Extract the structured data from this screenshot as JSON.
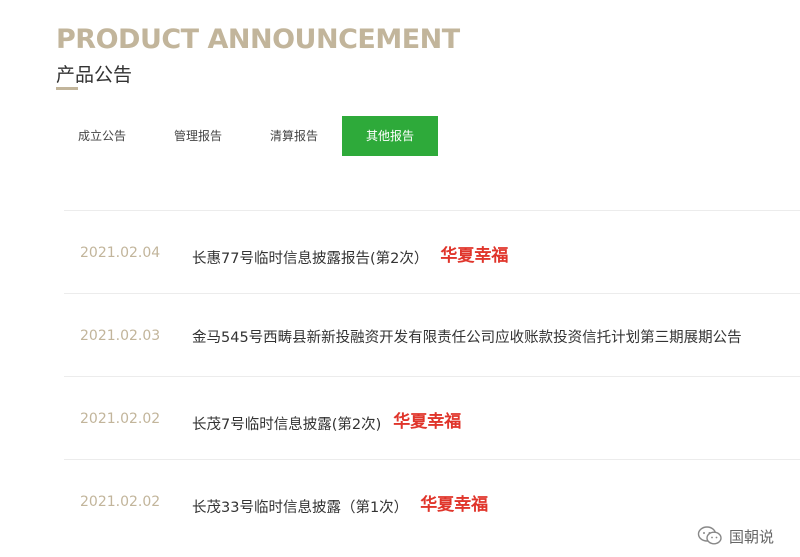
{
  "header": {
    "title_en": "PRODUCT ANNOUNCEMENT",
    "title_cn": "产品公告"
  },
  "tabs": [
    {
      "label": "成立公告",
      "active": false
    },
    {
      "label": "管理报告",
      "active": false
    },
    {
      "label": "清算报告",
      "active": false
    },
    {
      "label": "其他报告",
      "active": true
    }
  ],
  "announcements": [
    {
      "date": "2021.02.04",
      "title": "长惠77号临时信息披露报告(第2次）",
      "tag": "华夏幸福"
    },
    {
      "date": "2021.02.03",
      "title": "金马545号西畴县新新投融资开发有限责任公司应收账款投资信托计划第三期展期公告",
      "tag": ""
    },
    {
      "date": "2021.02.02",
      "title": "长茂7号临时信息披露(第2次)",
      "tag": "华夏幸福"
    },
    {
      "date": "2021.02.02",
      "title": "长茂33号临时信息披露（第1次）",
      "tag": "华夏幸福"
    }
  ],
  "watermark": {
    "text": "国朝说",
    "icon": "wechat-icon"
  },
  "colors": {
    "accent_gold": "#c2b59b",
    "active_tab": "#2eaa3a",
    "tag_red": "#e0352b"
  }
}
